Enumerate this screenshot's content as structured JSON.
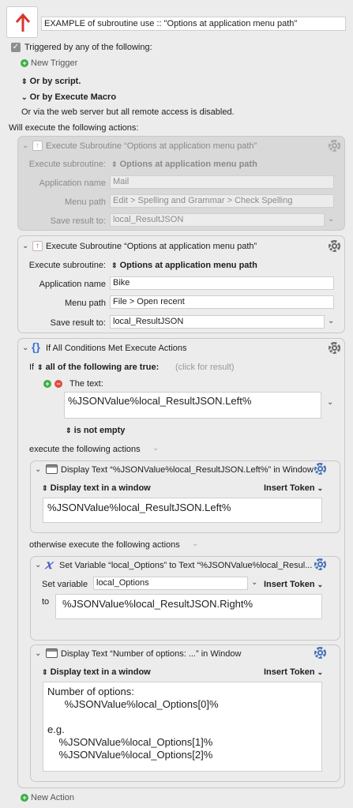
{
  "macro": {
    "icon_color": "#d8362b",
    "name": "EXAMPLE of subroutine use :: \"Options at application menu path\""
  },
  "trigger": {
    "checkbox_label": "Triggered by any of the following:",
    "new_trigger": "New Trigger",
    "or_by_script": "Or by script.",
    "or_by_execute_macro": "Or by Execute Macro",
    "web_server_note": "Or via the web server but all remote access is disabled."
  },
  "actions_heading": "Will execute the following actions:",
  "action1": {
    "title": "Execute Subroutine “Options at application menu path”",
    "exec_label": "Execute subroutine:",
    "exec_value": "Options at application menu path",
    "app_label": "Application name",
    "app_value": "Mail",
    "menu_label": "Menu path",
    "menu_value": "Edit > Spelling and Grammar > Check Spelling",
    "save_label": "Save result to:",
    "save_value": "local_ResultJSON"
  },
  "action2": {
    "title": "Execute Subroutine “Options at application menu path”",
    "exec_label": "Execute subroutine:",
    "exec_value": "Options at application menu path",
    "app_label": "Application name",
    "app_value": "Bike",
    "menu_label": "Menu path",
    "menu_value": "File > Open recent",
    "save_label": "Save result to:",
    "save_value": "local_ResultJSON"
  },
  "if_action": {
    "title": "If All Conditions Met Execute Actions",
    "if_label": "If",
    "condition_mode": "all of the following are true:",
    "click_hint": "(click for result)",
    "text_label": "The text:",
    "text_value": "%JSONValue%local_ResultJSON.Left%",
    "operator": "is not empty",
    "then_label": "execute the following actions",
    "else_label": "otherwise execute the following actions"
  },
  "display1": {
    "title": "Display Text “%JSONValue%local_ResultJSON.Left%” in Window",
    "mode": "Display text in a window",
    "insert_token": "Insert Token",
    "text": "%JSONValue%local_ResultJSON.Left%"
  },
  "setvar": {
    "title": "Set Variable “local_Options” to Text “%JSONValue%local_Resul...",
    "var_label": "Set variable",
    "var_value": "local_Options",
    "insert_token": "Insert Token",
    "to_label": "to",
    "to_value": "%JSONValue%local_ResultJSON.Right%"
  },
  "display2": {
    "title": "Display Text “Number of options: ...” in Window",
    "mode": "Display text in a window",
    "insert_token": "Insert Token",
    "text": "Number of options:\n      %JSONValue%local_Options[0]%\n\ne.g.\n    %JSONValue%local_Options[1]%\n    %JSONValue%local_Options[2]%"
  },
  "new_action": "New Action"
}
